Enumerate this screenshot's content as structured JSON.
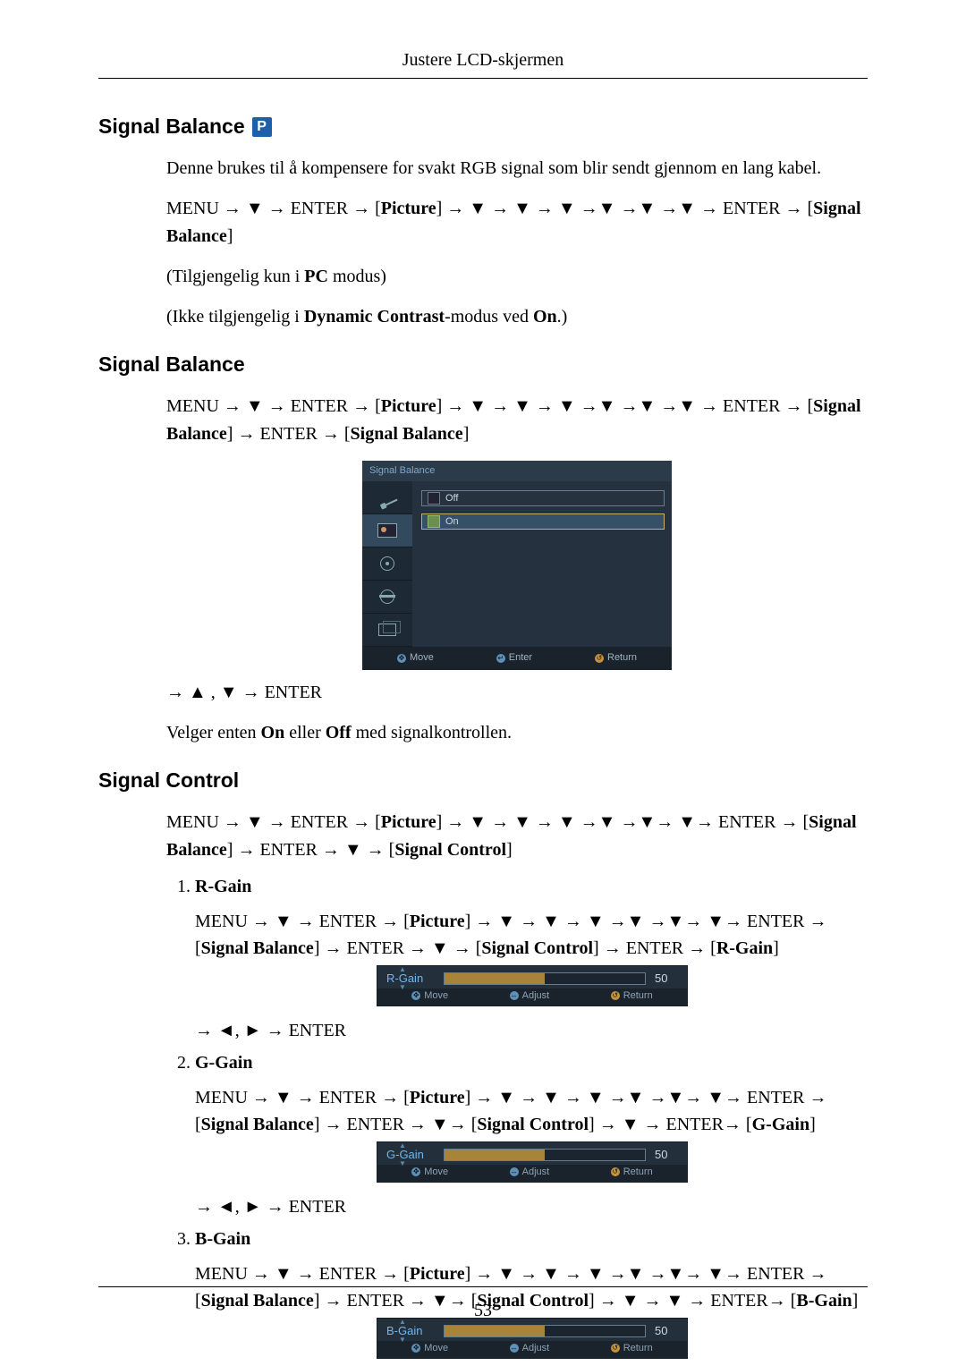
{
  "header": {
    "title": "Justere LCD-skjermen"
  },
  "page_number": "53",
  "badge": "P",
  "arrows": {
    "up": "▲",
    "down": "▼",
    "left": "◄",
    "right": "►",
    "to": "→"
  },
  "sec1": {
    "heading": "Signal Balance",
    "desc": "Denne brukes til å kompensere for svakt RGB signal som blir sendt gjennom en lang kabel.",
    "nav_pre": "MENU → ▼ → ENTER → [",
    "nav_picture": "Picture",
    "nav_mid": "] → ▼ → ▼ → ▼ →▼ →▼ →▼ → ENTER → [",
    "nav_sb": "Signal Balance",
    "nav_end": "]",
    "avail_pre": "(Tilgjengelig kun i ",
    "avail_pc": "PC",
    "avail_post": " modus)",
    "na_pre": "(Ikke tilgjengelig i ",
    "na_dc": "Dynamic Contrast",
    "na_mid": "-modus ved ",
    "na_on": "On",
    "na_post": ".)"
  },
  "sec2": {
    "heading": "Signal Balance",
    "nav_pre": "MENU → ▼ → ENTER → [",
    "nav_picture": "Picture",
    "nav_mid": "] → ▼ → ▼ → ▼ →▼ →▼ →▼ → ENTER → [",
    "nav_sb": "Signal Balance",
    "nav_mid2": "] → ENTER → [",
    "nav_sb2": "Signal Balance",
    "nav_end": "]",
    "after_pre": "→ ▲ , ▼ → ENTER",
    "choose_pre": "Velger enten ",
    "choose_on": "On",
    "choose_mid": " eller ",
    "choose_off": "Off",
    "choose_post": " med signalkontrollen."
  },
  "osd": {
    "title": "Signal Balance",
    "opt_off": "Off",
    "opt_on": "On",
    "footer": {
      "move": "Move",
      "enter": "Enter",
      "ret": "Return"
    }
  },
  "sec3": {
    "heading": "Signal Control",
    "nav_pre": "MENU → ▼ → ENTER → [",
    "nav_picture": "Picture",
    "nav_mid": "] → ▼ → ▼ → ▼ →▼ →▼→ ▼→ ENTER → [",
    "nav_sb": "Signal Balance",
    "nav_mid2": "] → ENTER → ▼ → [",
    "nav_sc": "Signal Control",
    "nav_end": "]"
  },
  "gains": {
    "r": {
      "title": "R-Gain",
      "nav": "MENU → ▼ → ENTER → [Picture] → ▼ → ▼ → ▼ →▼ →▼→ ▼→ ENTER → [Signal Balance] → ENTER → ▼ → [Signal Control] → ENTER → [R-Gain]",
      "nav_pre": "MENU → ▼ → ENTER → [",
      "nav_pic": "Picture",
      "nav_mid": "] → ▼ → ▼ → ▼ →▼ →▼→ ▼→ ENTER → [",
      "nav_sb": "Signal Balance",
      "nav_mid2": "] → ENTER → ▼ → [",
      "nav_sc": "Signal Control",
      "nav_mid3": "] → ENTER → [",
      "nav_rg": "R-Gain",
      "nav_end": "]",
      "after": "→ ◄, ► → ENTER",
      "value": "50",
      "label": "R-Gain"
    },
    "g": {
      "title": "G-Gain",
      "nav_pre": "MENU → ▼ → ENTER → [",
      "nav_pic": "Picture",
      "nav_mid": "] → ▼ → ▼ → ▼ →▼ →▼→ ▼→ ENTER → [",
      "nav_sb": "Signal Balance",
      "nav_mid2": "] → ENTER → ▼→ [",
      "nav_sc": "Signal Control",
      "nav_mid3": "] → ▼ → ENTER→ [",
      "nav_gg": "G-Gain",
      "nav_end": "]",
      "after": "→ ◄, ► → ENTER",
      "value": "50",
      "label": "G-Gain"
    },
    "b": {
      "title": "B-Gain",
      "nav_pre": "MENU → ▼ → ENTER → [",
      "nav_pic": "Picture",
      "nav_mid": "] → ▼ → ▼ → ▼ →▼ →▼→ ▼→ ENTER → [",
      "nav_sb": "Signal Balance",
      "nav_mid2": "] → ENTER → ▼→ [",
      "nav_sc": "Signal Control",
      "nav_mid3": "] → ▼ → ▼ → ENTER→ [",
      "nav_bg": "B-Gain",
      "nav_end": "]",
      "value": "50",
      "label": "B-Gain"
    }
  },
  "mini_footer": {
    "move": "Move",
    "adjust": "Adjust",
    "ret": "Return"
  }
}
